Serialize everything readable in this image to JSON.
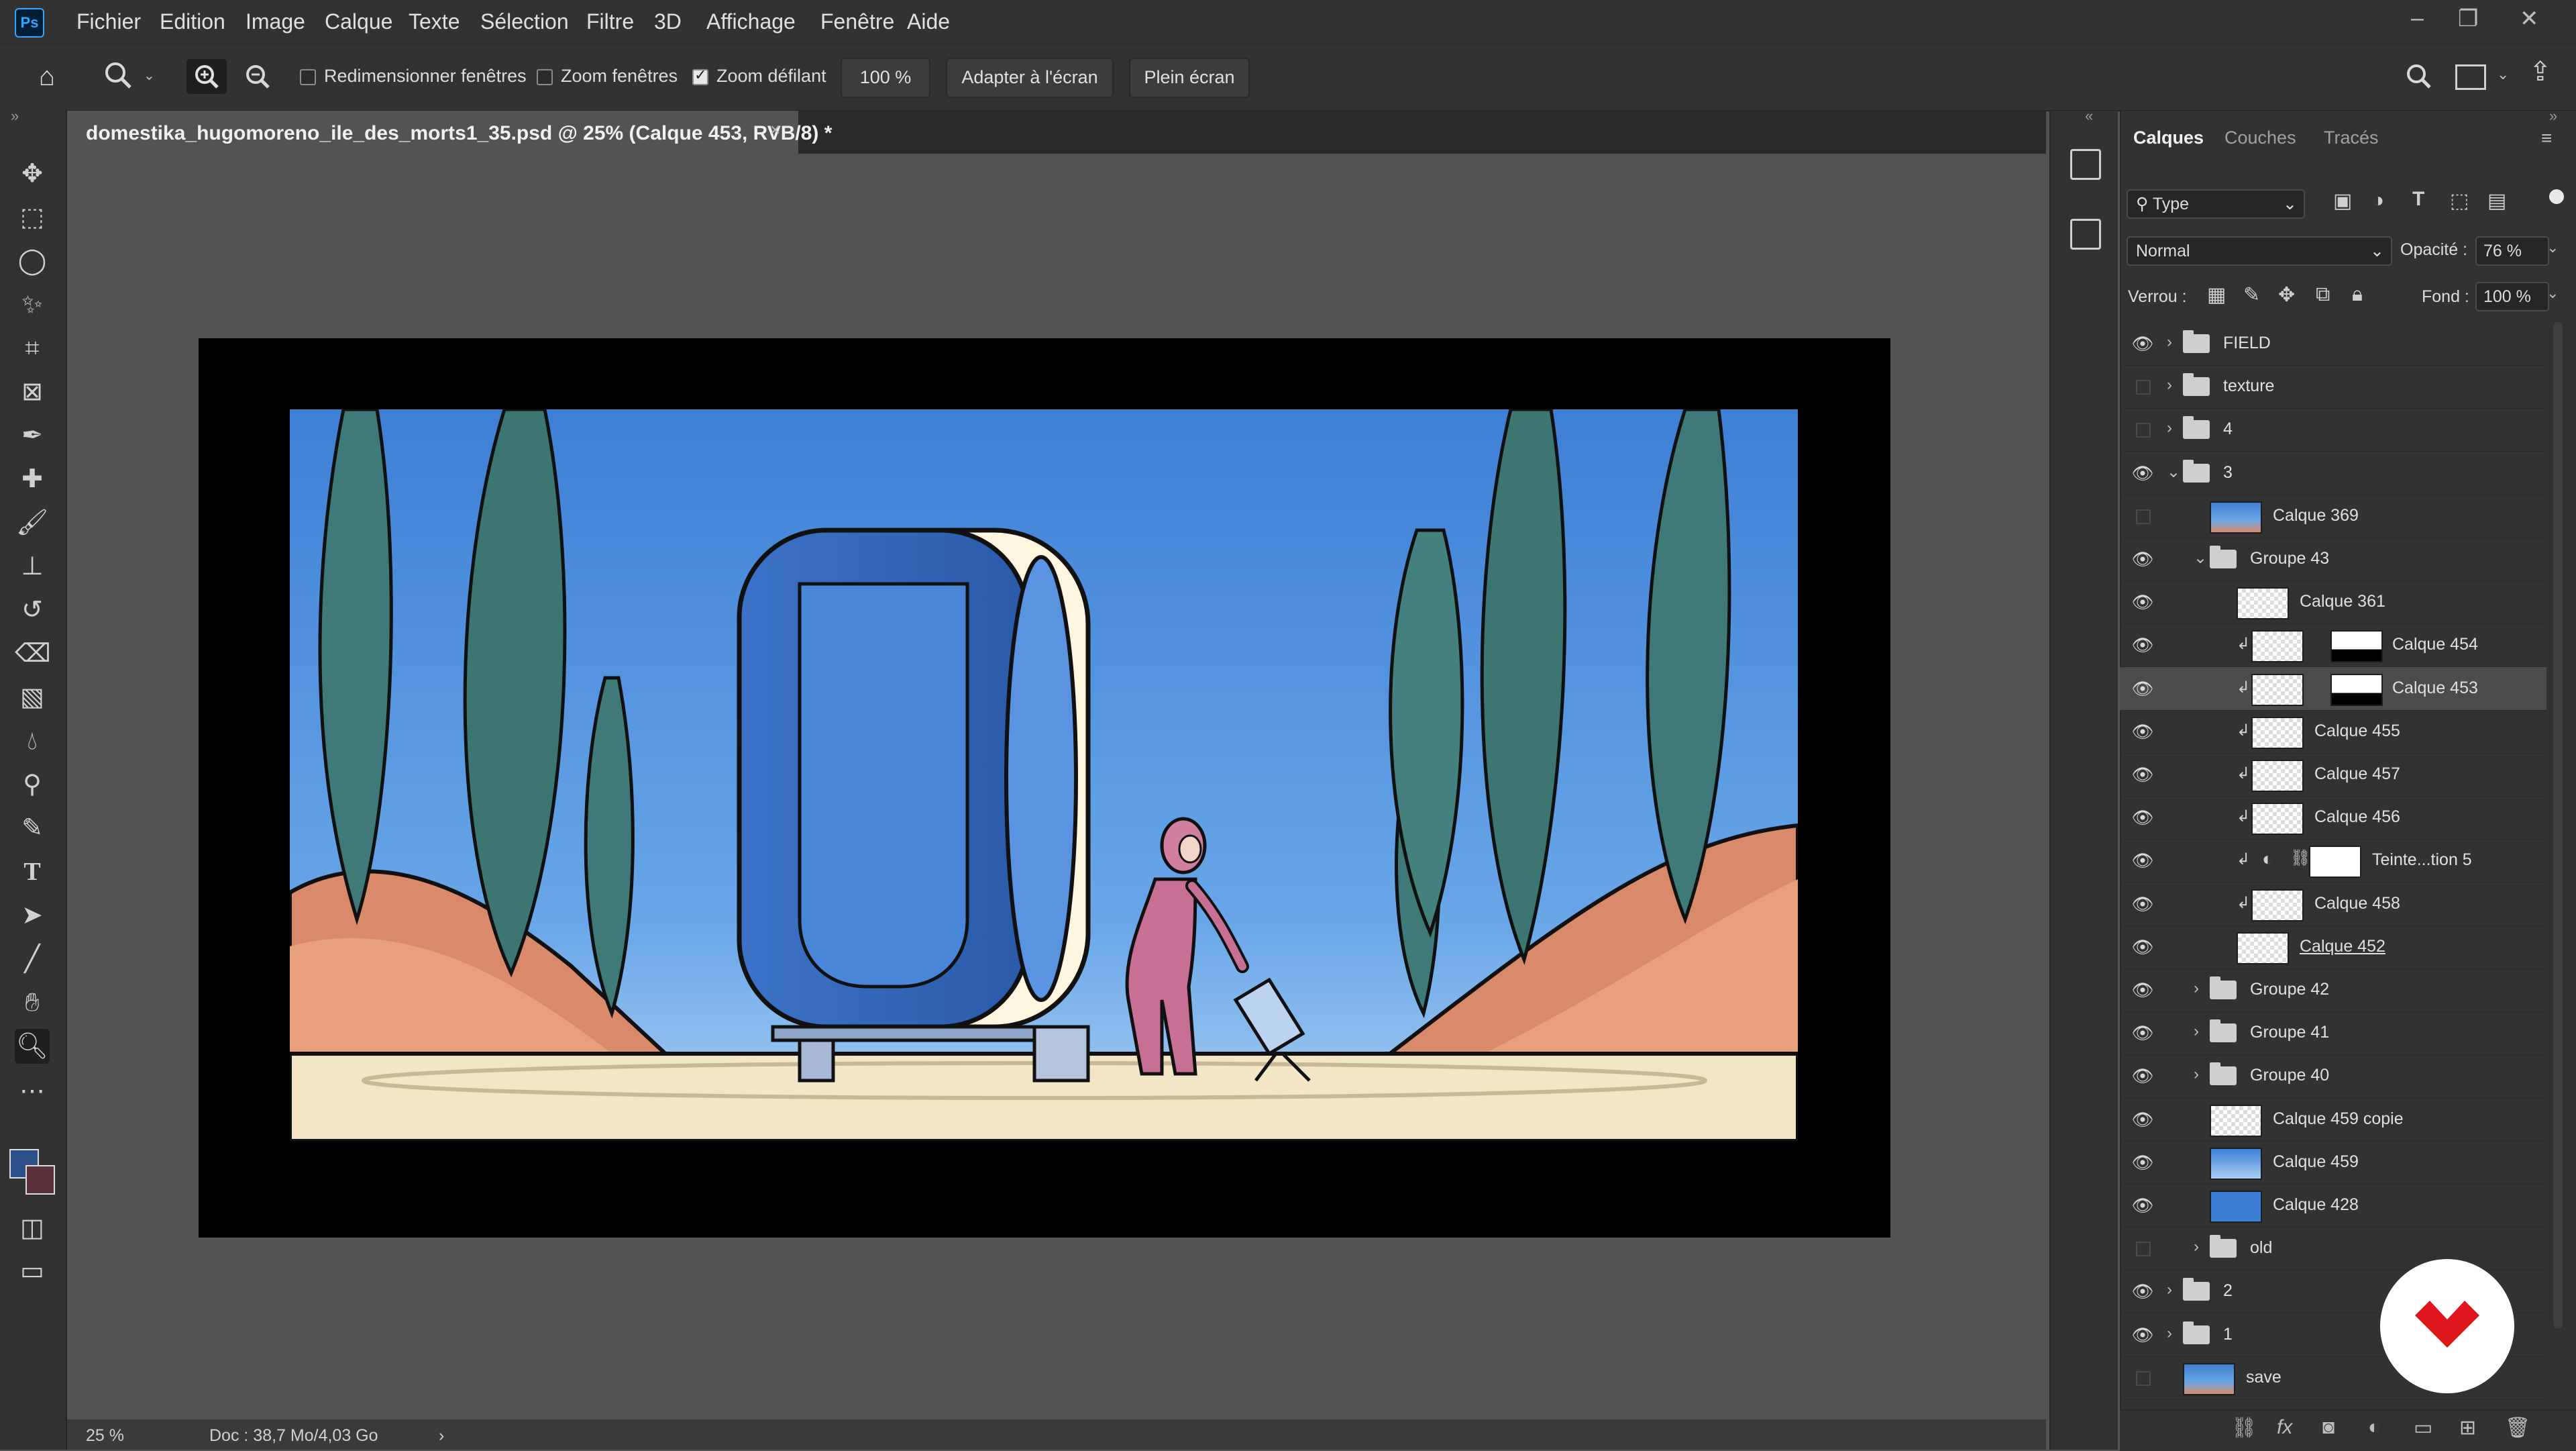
{
  "app": {
    "logo": "Ps"
  },
  "menu": [
    "Fichier",
    "Edition",
    "Image",
    "Calque",
    "Texte",
    "Sélection",
    "Filtre",
    "3D",
    "Affichage",
    "Fenêtre",
    "Aide"
  ],
  "options": {
    "resize_windows": "Redimensionner fenêtres",
    "zoom_all": "Zoom fenêtres",
    "scrubby_zoom": "Zoom défilant",
    "zoom_value": "100 %",
    "fit_screen": "Adapter à l'écran",
    "full_screen": "Plein écran"
  },
  "document": {
    "title": "domestika_hugomoreno_ile_des_morts1_35.psd @ 25% (Calque 453, RVB/8)",
    "modified": "*"
  },
  "status": {
    "zoom": "25 %",
    "doc": "Doc : 38,7 Mo/4,03 Go"
  },
  "layers_panel": {
    "tabs": [
      "Calques",
      "Couches",
      "Tracés"
    ],
    "filter_type": "Type",
    "blend_mode": "Normal",
    "opacity_label": "Opacité :",
    "opacity_value": "76 %",
    "lock_label": "Verrou :",
    "fill_label": "Fond :",
    "fill_value": "100 %",
    "layers": [
      {
        "name": "FIELD",
        "kind": "group",
        "visible": true,
        "indent": 0,
        "expanded": false
      },
      {
        "name": "texture",
        "kind": "group",
        "visible": false,
        "indent": 0,
        "expanded": false
      },
      {
        "name": "4",
        "kind": "group",
        "visible": false,
        "indent": 0,
        "expanded": false
      },
      {
        "name": "3",
        "kind": "group",
        "visible": true,
        "indent": 0,
        "expanded": true
      },
      {
        "name": "Calque 369",
        "kind": "image",
        "visible": false,
        "indent": 1
      },
      {
        "name": "Groupe 43",
        "kind": "group",
        "visible": true,
        "indent": 1,
        "expanded": true
      },
      {
        "name": "Calque 361",
        "kind": "layer",
        "visible": true,
        "indent": 2
      },
      {
        "name": "Calque 454",
        "kind": "clip-mask",
        "visible": true,
        "indent": 2
      },
      {
        "name": "Calque 453",
        "kind": "clip-mask",
        "visible": true,
        "indent": 2,
        "selected": true
      },
      {
        "name": "Calque 455",
        "kind": "clip",
        "visible": true,
        "indent": 2
      },
      {
        "name": "Calque 457",
        "kind": "clip",
        "visible": true,
        "indent": 2
      },
      {
        "name": "Calque 456",
        "kind": "clip",
        "visible": true,
        "indent": 2
      },
      {
        "name": "Teinte...tion 5",
        "kind": "adjust",
        "visible": true,
        "indent": 2
      },
      {
        "name": "Calque 458",
        "kind": "clip",
        "visible": true,
        "indent": 2
      },
      {
        "name": "Calque 452",
        "kind": "layer",
        "visible": true,
        "indent": 2
      },
      {
        "name": "Groupe 42",
        "kind": "group",
        "visible": true,
        "indent": 1,
        "expanded": false
      },
      {
        "name": "Groupe 41",
        "kind": "group",
        "visible": true,
        "indent": 1,
        "expanded": false
      },
      {
        "name": "Groupe 40",
        "kind": "group",
        "visible": true,
        "indent": 1,
        "expanded": false
      },
      {
        "name": "Calque 459 copie",
        "kind": "layer",
        "visible": true,
        "indent": 1
      },
      {
        "name": "Calque 459",
        "kind": "gradient",
        "visible": true,
        "indent": 1
      },
      {
        "name": "Calque 428",
        "kind": "blue",
        "visible": true,
        "indent": 1
      },
      {
        "name": "old",
        "kind": "group",
        "visible": false,
        "indent": 1,
        "expanded": false
      },
      {
        "name": "2",
        "kind": "group",
        "visible": true,
        "indent": 0,
        "expanded": false
      },
      {
        "name": "1",
        "kind": "group",
        "visible": true,
        "indent": 0,
        "expanded": false
      },
      {
        "name": "save",
        "kind": "image",
        "visible": false,
        "indent": 0
      }
    ]
  },
  "colors": {
    "accent": "#31a8ff",
    "foreground": "#2d4f8a",
    "background": "#5a2f3a",
    "domestika": "#e0161d"
  }
}
